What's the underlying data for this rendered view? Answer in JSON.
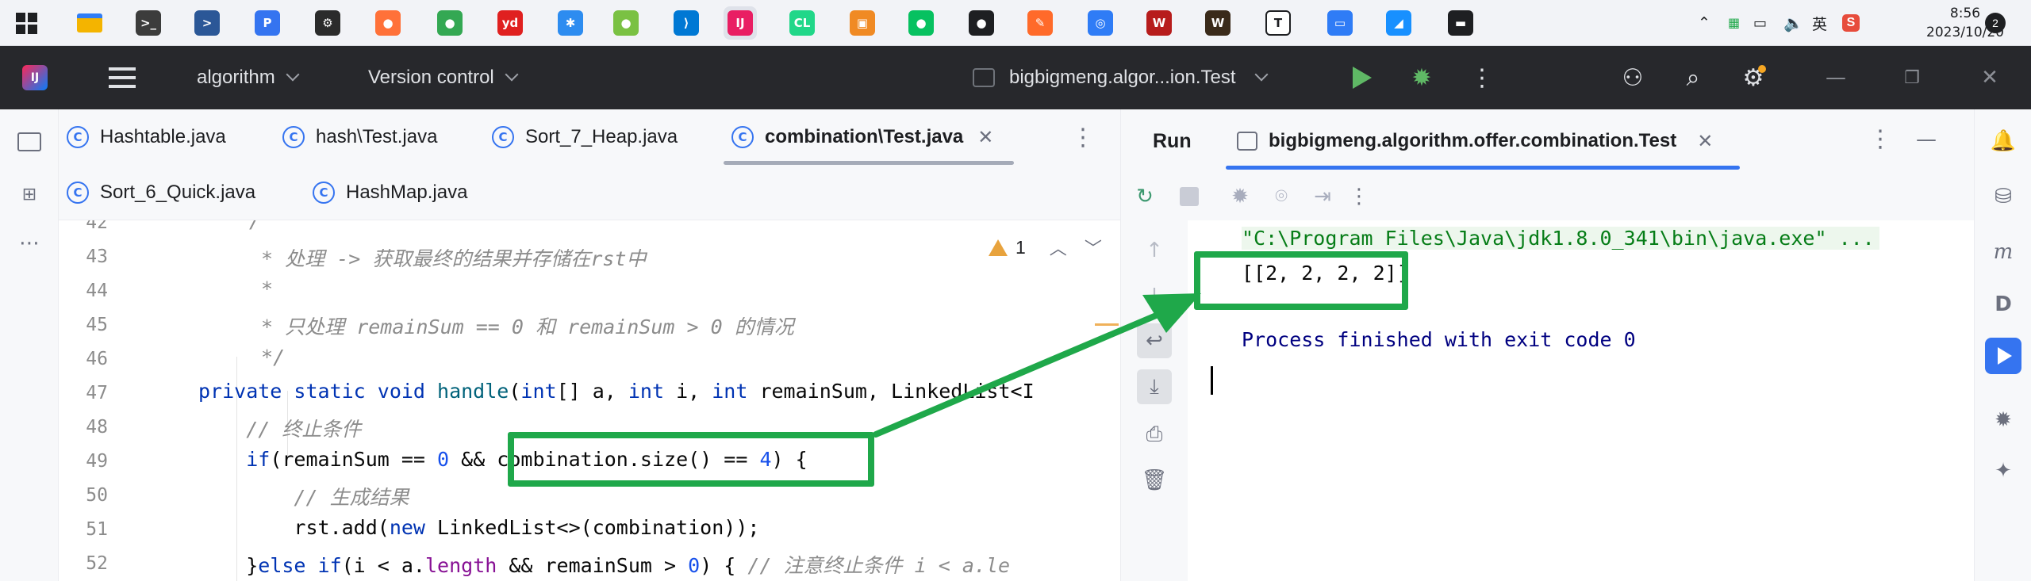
{
  "taskbar": {
    "icons": [
      {
        "name": "windows-start-icon",
        "glyph": "",
        "color": "#1e1f22"
      },
      {
        "name": "file-explorer-icon",
        "glyph": "",
        "color": "#f4b400"
      },
      {
        "name": "terminal-icon",
        "glyph": ">_",
        "color": "#3c3c3c"
      },
      {
        "name": "powershell-icon",
        "glyph": ">",
        "color": "#2b5797"
      },
      {
        "name": "app-p-icon",
        "glyph": "P",
        "color": "#3574f0"
      },
      {
        "name": "settings-gear-icon",
        "glyph": "⚙",
        "color": "#2b2b2b"
      },
      {
        "name": "firefox-icon",
        "glyph": "●",
        "color": "#ff7139"
      },
      {
        "name": "chrome-icon",
        "glyph": "●",
        "color": "#34a853"
      },
      {
        "name": "youdao-icon",
        "glyph": "yd",
        "color": "#e02020"
      },
      {
        "name": "app-blue-icon",
        "glyph": "✱",
        "color": "#2d8cf0"
      },
      {
        "name": "app-green-icon",
        "glyph": "●",
        "color": "#7ac143"
      },
      {
        "name": "vscode-icon",
        "glyph": "⟩",
        "color": "#0078d4"
      },
      {
        "name": "intellij-icon",
        "glyph": "IJ",
        "color": "#e91e63"
      },
      {
        "name": "clion-icon",
        "glyph": "CL",
        "color": "#21d789"
      },
      {
        "name": "app-orange-blue-icon",
        "glyph": "▣",
        "color": "#f08a24"
      },
      {
        "name": "wechat-icon",
        "glyph": "●",
        "color": "#07c160"
      },
      {
        "name": "qq-icon",
        "glyph": "●",
        "color": "#1e1f22"
      },
      {
        "name": "app-feather-icon",
        "glyph": "✎",
        "color": "#ff6a2a"
      },
      {
        "name": "baidu-netdisk-icon",
        "glyph": "◎",
        "color": "#2f7cf6"
      },
      {
        "name": "app-red-shield-icon",
        "glyph": "W",
        "color": "#b71c1c"
      },
      {
        "name": "app-w-icon",
        "glyph": "W",
        "color": "#3a2a1a"
      },
      {
        "name": "typora-icon",
        "glyph": "T",
        "color": "#ffffff"
      },
      {
        "name": "remote-desktop-icon",
        "glyph": "▭",
        "color": "#2f7cf6"
      },
      {
        "name": "app-wave-icon",
        "glyph": "◢",
        "color": "#1890ff"
      },
      {
        "name": "cmd-icon",
        "glyph": "▬",
        "color": "#1e1f22"
      }
    ],
    "tray_lang": "英",
    "tray_sogou": "S",
    "time": "8:56",
    "date": "2023/10/20",
    "notification_count": "2"
  },
  "toolbar": {
    "project": "algorithm",
    "vcs": "Version control",
    "run_config": "bigbigmeng.algor...ion.Test"
  },
  "editor": {
    "tabs_row1": [
      {
        "label": "Hashtable.java"
      },
      {
        "label": "hash\\Test.java"
      },
      {
        "label": "Sort_7_Heap.java"
      },
      {
        "label": "combination\\Test.java",
        "active": true
      }
    ],
    "tabs_row2": [
      {
        "label": "Sort_6_Quick.java"
      },
      {
        "label": "HashMap.java"
      }
    ],
    "warning_count": "1",
    "line_numbers": [
      "42",
      "43",
      "44",
      "45",
      "46",
      "47",
      "48",
      "49",
      "50",
      "51",
      "52"
    ],
    "code": [
      {
        "segs": [
          [
            "cmt",
            "/"
          ]
        ]
      },
      {
        "segs": [
          [
            "cmt",
            " * 处理 -> 获取最终的结果并存储在rst中"
          ]
        ]
      },
      {
        "segs": [
          [
            "cmt",
            " *"
          ]
        ]
      },
      {
        "segs": [
          [
            "cmt",
            " * 只处理 remainSum == 0 和 remainSum > 0 的情况"
          ]
        ]
      },
      {
        "segs": [
          [
            "cmt",
            " */"
          ]
        ]
      },
      {
        "segs": [
          [
            "kw",
            "private static void "
          ],
          [
            "fn",
            "handle"
          ],
          [
            "",
            "("
          ],
          [
            "kw",
            "int"
          ],
          [
            "",
            "[] a, "
          ],
          [
            "kw",
            "int"
          ],
          [
            "",
            " i, "
          ],
          [
            "kw",
            "int"
          ],
          [
            "",
            " remainSum, LinkedList<I"
          ]
        ]
      },
      {
        "segs": [
          [
            "cmt",
            "    // 终止条件"
          ]
        ]
      },
      {
        "segs": [
          [
            "kw",
            "    if"
          ],
          [
            "",
            "(remainSum == "
          ],
          [
            "num",
            "0"
          ],
          [
            "",
            " && combination.size() == "
          ],
          [
            "num",
            "4"
          ],
          [
            "",
            ") {"
          ]
        ]
      },
      {
        "segs": [
          [
            "cmt",
            "        // 生成结果"
          ]
        ]
      },
      {
        "segs": [
          [
            "",
            "        rst.add("
          ],
          [
            "kw",
            "new"
          ],
          [
            "",
            " LinkedList<>(combination));"
          ]
        ]
      },
      {
        "segs": [
          [
            "",
            "    }"
          ],
          [
            "kw",
            "else if"
          ],
          [
            "",
            "(i < a."
          ],
          [
            "field",
            "length"
          ],
          [
            "",
            " && remainSum > "
          ],
          [
            "num",
            "0"
          ],
          [
            "",
            ") { "
          ],
          [
            "cmt",
            "// 注意终止条件 i < a.le"
          ]
        ]
      }
    ]
  },
  "run": {
    "title": "Run",
    "tab_label": "bigbigmeng.algorithm.offer.combination.Test",
    "console": [
      {
        "kind": "cmd",
        "text": "\"C:\\Program Files\\Java\\jdk1.8.0_341\\bin\\java.exe\" ..."
      },
      {
        "kind": "out",
        "text": "[[2, 2, 2, 2]]"
      },
      {
        "kind": "blank",
        "text": ""
      },
      {
        "kind": "exit",
        "text": "Process finished with exit code 0"
      }
    ]
  },
  "annotation": {
    "color": "#1fa84a"
  }
}
